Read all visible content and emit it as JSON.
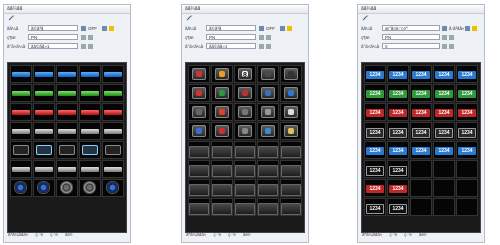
{
  "panels": [
    {
      "title": "ãã¼ãã",
      "part_label": "ãã¼ã",
      "part_value": "ã©ã³ã",
      "off_label": "OFF",
      "state_label": "ç¶æ",
      "state_value": "PN",
      "group_label": "ã°ã«ã¼ã",
      "group_value": "ãã©ãã»1"
    },
    {
      "title": "ãã¼ãã",
      "part_label": "ãã¼ã",
      "part_value": "ã©ã³ã",
      "off_label": "OFF",
      "state_label": "ç¶æ",
      "state_value": "PN",
      "group_label": "ã°ã«ã¼ã",
      "group_value": "ãã©ãã»1"
    },
    {
      "title": "ãã¼ãã",
      "part_label": "ãã¼ã",
      "part_value": "æ°å¤è¡¨ç¤º",
      "off_label": "ã·ã³ãã«",
      "state_label": "ç¶æ",
      "state_value": "PN",
      "group_label": "ã°ã«ã¼ã",
      "group_value": "0"
    }
  ],
  "footer": [
    "ãªã¼ããã«",
    "ç·¨é",
    "ç·¨é",
    "åé¤"
  ],
  "number_text": "1234",
  "icons": [
    "alarm-clock-icon",
    "photos-icon",
    "calendar-icon",
    "blank-tile-icon",
    "camera-lens-icon",
    "alarm-icon",
    "film-icon",
    "list-icon",
    "chart-icon",
    "camera-icon",
    "screen-icon",
    "lamp-icon",
    "disk-icon",
    "door-icon",
    "document-icon",
    "monitor-icon",
    "warning-icon",
    "disc-icon",
    "shield-icon",
    "book-icon"
  ],
  "calendar_day": "8"
}
